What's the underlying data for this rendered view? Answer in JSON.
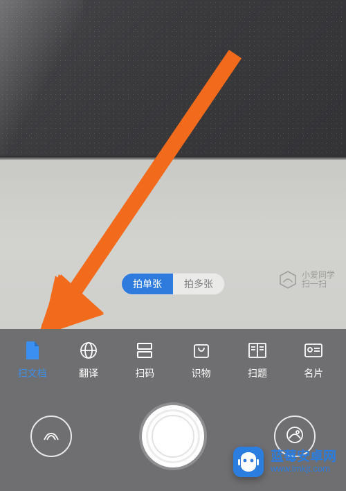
{
  "shotMode": {
    "single": "拍单张",
    "multi": "拍多张"
  },
  "xiaoai": {
    "line1": "小爱同学",
    "line2": "扫一扫"
  },
  "modes": {
    "doc": "扫文档",
    "translate": "翻译",
    "qrcode": "扫码",
    "detect": "识物",
    "homework": "扫题",
    "card": "名片"
  },
  "watermark": {
    "name": "蓝莓安卓网",
    "url": "www.lmkjt.com"
  },
  "colors": {
    "accent": "#3a8ff0",
    "arrow": "#f26a1b"
  }
}
